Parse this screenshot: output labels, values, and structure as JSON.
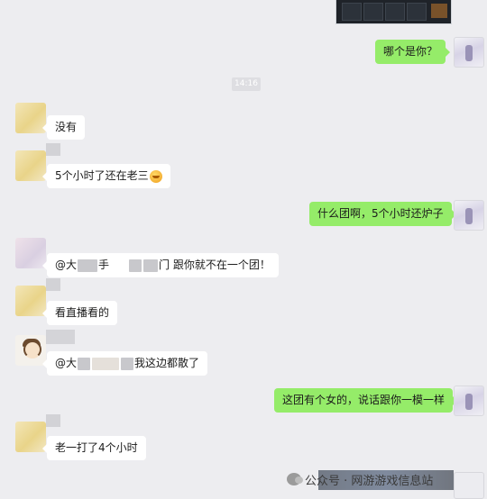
{
  "chat": {
    "timestamp": "14:16",
    "messages": [
      {
        "id": "m1",
        "direction": "out",
        "text": "哪个是你？"
      },
      {
        "id": "m2",
        "direction": "in",
        "text": "没有"
      },
      {
        "id": "m3",
        "direction": "in",
        "text": "5个小时了还在老三"
      },
      {
        "id": "m4",
        "direction": "out",
        "text": "什么团啊，5个小时还炉子"
      },
      {
        "id": "m5",
        "direction": "in",
        "text_a": "@大",
        "text_b": "手",
        "text_c": "门 跟你就不在一个团！"
      },
      {
        "id": "m6",
        "direction": "in",
        "text": "看直播看的"
      },
      {
        "id": "m7",
        "direction": "in",
        "text_a": "@大",
        "text_b": "我这边都散了"
      },
      {
        "id": "m8",
        "direction": "out",
        "text": "这团有个女的，说话跟你一模一样"
      },
      {
        "id": "m9",
        "direction": "in",
        "text": "老一打了4个小时"
      }
    ]
  },
  "watermark": {
    "text": "公众号 · 网游游戏信息站"
  },
  "colors": {
    "background": "#ededf0",
    "outgoing_bubble": "#95ec69",
    "incoming_bubble": "#ffffff"
  },
  "icons": {
    "wechat_official": "wechat-official-account-icon",
    "emoji": "grinning-sweat-emoji"
  }
}
